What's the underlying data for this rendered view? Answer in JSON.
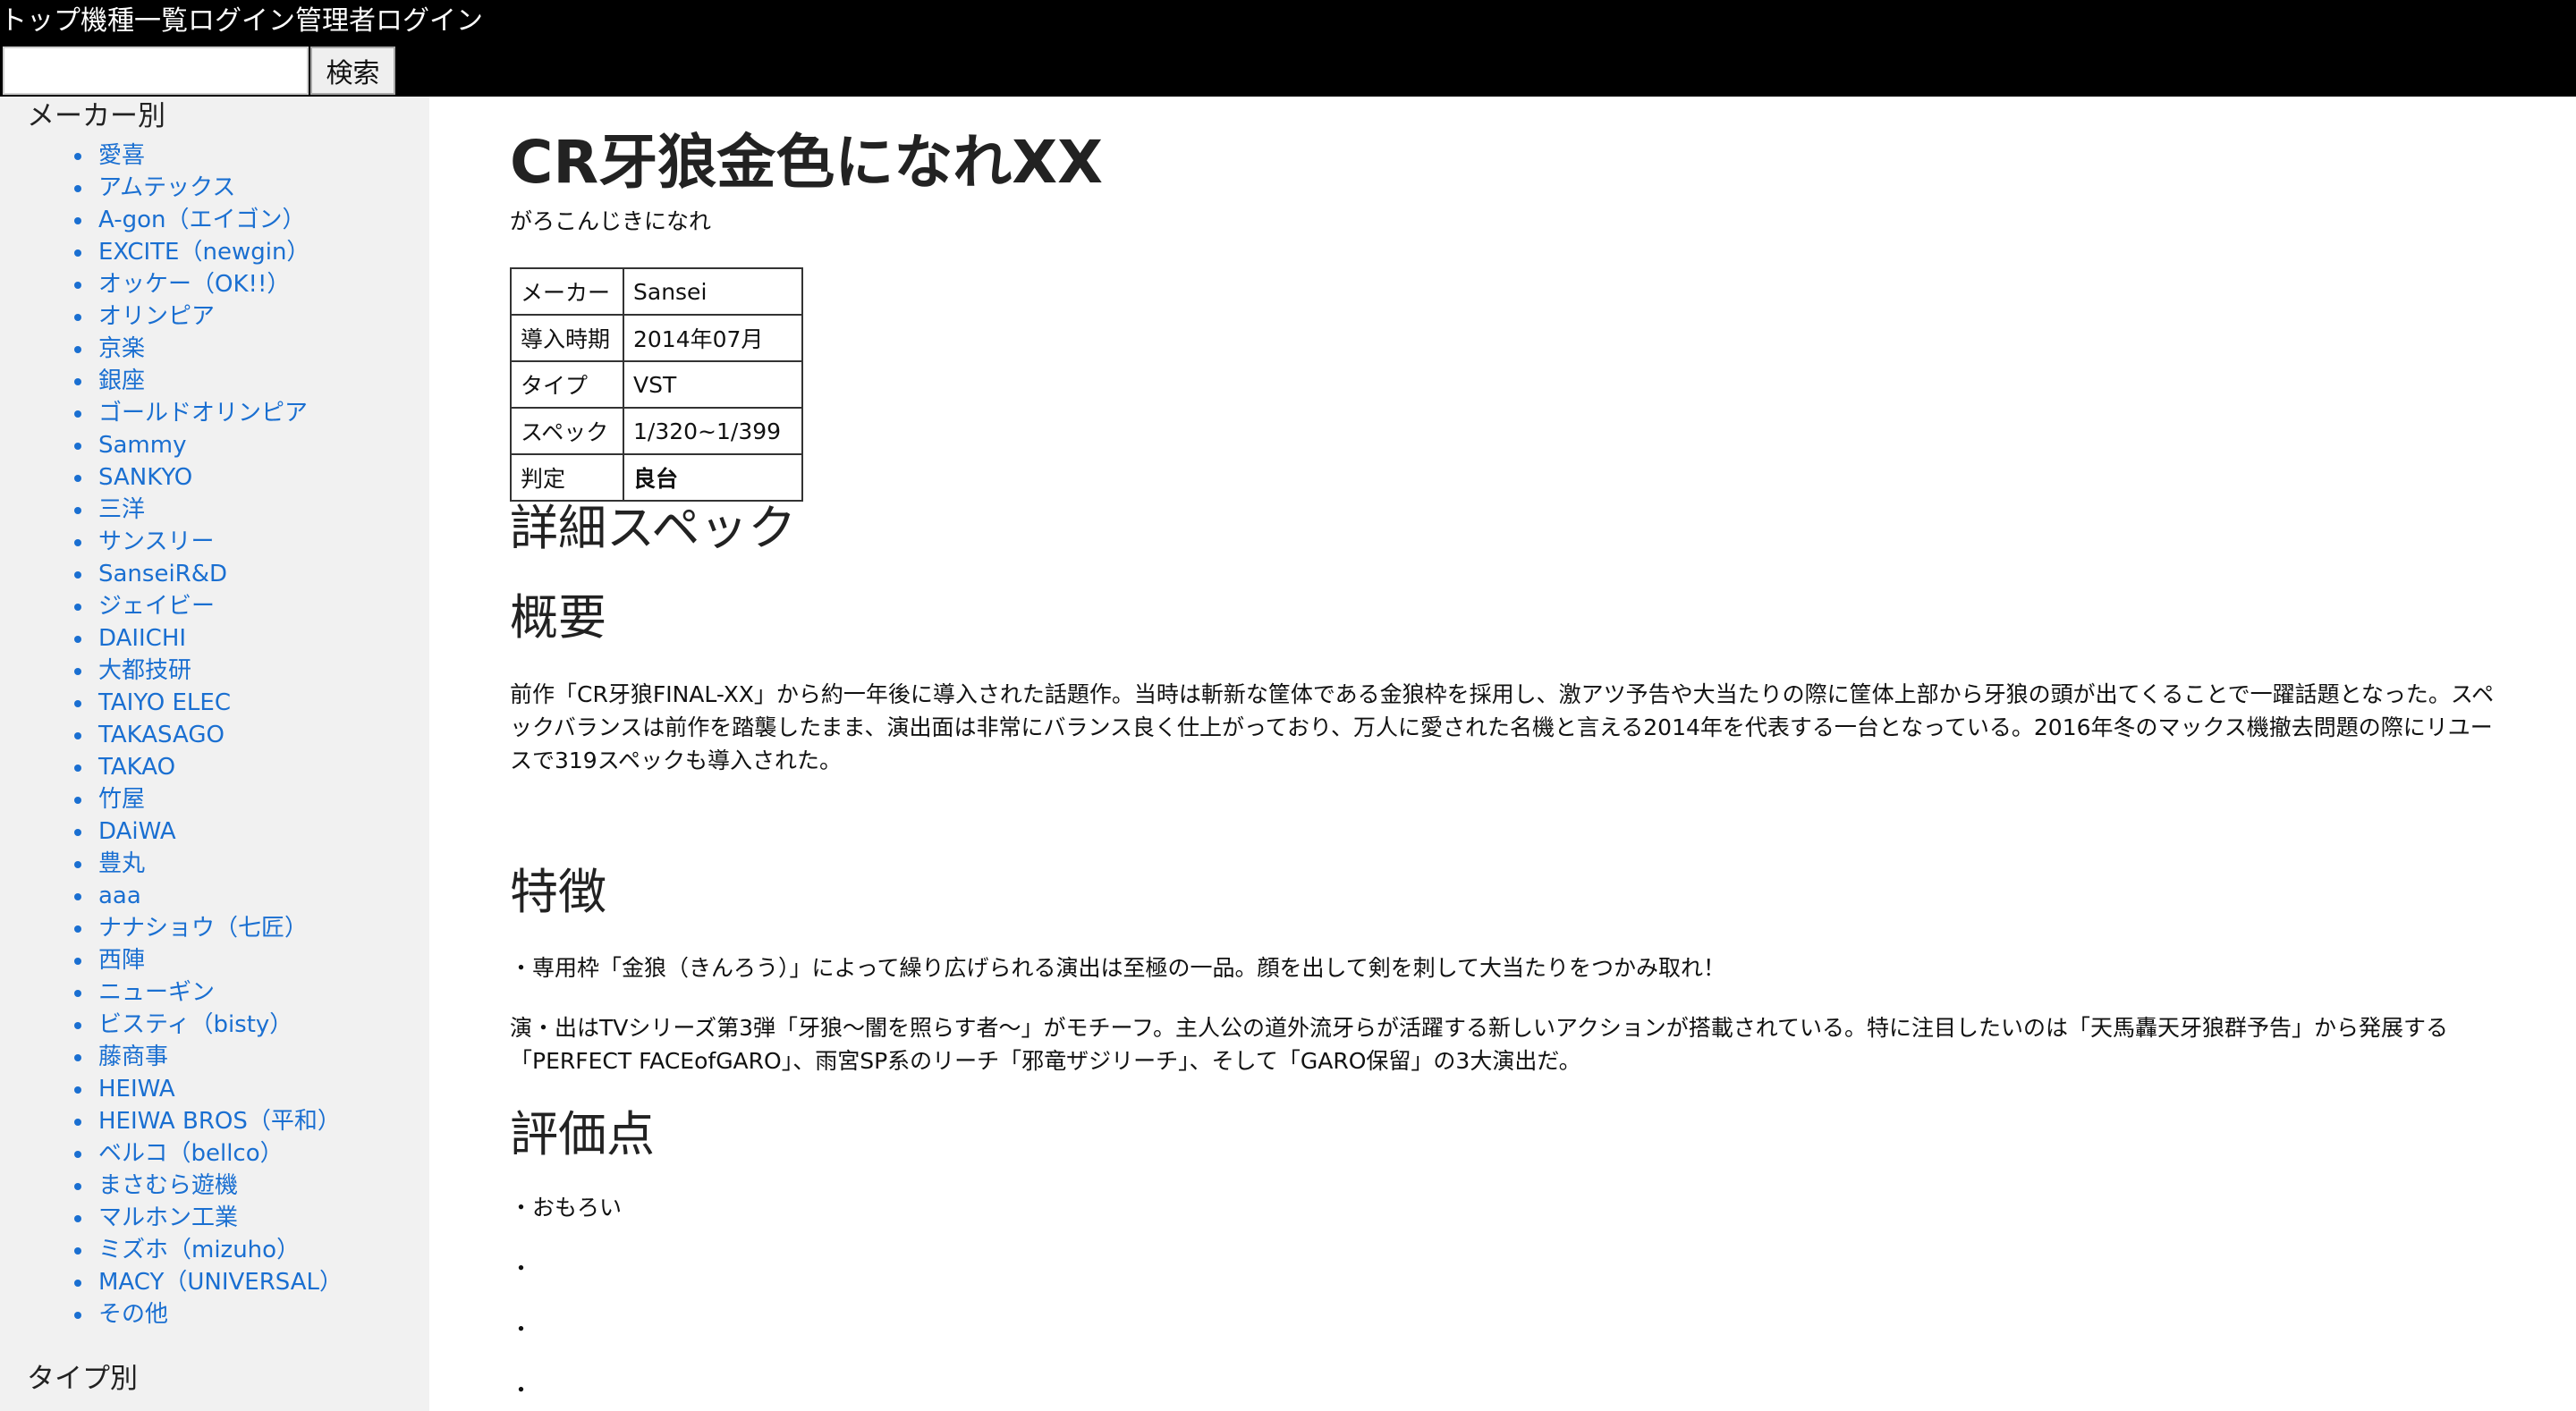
{
  "nav": {
    "top": "トップ",
    "models": "機種一覧",
    "login": "ログイン",
    "admin_login": "管理者ログイン"
  },
  "search": {
    "value": "",
    "button_label": "検索"
  },
  "sidebar": {
    "maker_heading": "メーカー別",
    "makers": [
      "愛喜",
      "アムテックス",
      "A-gon（エイゴン）",
      "EXCITE（newgin）",
      "オッケー（OK!!）",
      "オリンピア",
      "京楽",
      "銀座",
      "ゴールドオリンピア",
      "Sammy",
      "SANKYO",
      "三洋",
      "サンスリー",
      "SanseiR&D",
      "ジェイビー",
      "DAIICHI",
      "大都技研",
      "TAIYO ELEC",
      "TAKASAGO",
      "TAKAO",
      "竹屋",
      "DAiWA",
      "豊丸",
      "aaa",
      "ナナショウ（七匠）",
      "西陣",
      "ニューギン",
      "ビスティ（bisty）",
      "藤商事",
      "HEIWA",
      "HEIWA BROS（平和）",
      "ベルコ（bellco）",
      "まさむら遊機",
      "マルホン工業",
      "ミズホ（mizuho）",
      "MACY（UNIVERSAL）",
      "その他"
    ],
    "type_heading": "タイプ別"
  },
  "main": {
    "title": "CR牙狼金色になれXX",
    "subtitle": "がろこんじきになれ",
    "spec_rows": [
      {
        "label": "メーカー",
        "value": "Sansei"
      },
      {
        "label": "導入時期",
        "value": "2014年07月"
      },
      {
        "label": "タイプ",
        "value": "VST"
      },
      {
        "label": "スペック",
        "value": "1/320~1/399"
      },
      {
        "label": "判定",
        "value": "良台"
      }
    ],
    "detail_heading": "詳細スペック",
    "overview_heading": "概要",
    "overview_text": "前作「CR牙狼FINAL-XX」から約一年後に導入された話題作。当時は斬新な筐体である金狼枠を採用し、激アツ予告や大当たりの際に筐体上部から牙狼の頭が出てくることで一躍話題となった。スペックバランスは前作を踏襲したまま、演出面は非常にバランス良く仕上がっており、万人に愛された名機と言える2014年を代表する一台となっている。2016年冬のマックス機撤去問題の際にリユースで319スペックも導入された。",
    "features_heading": "特徴",
    "features_text_1": "・専用枠「金狼（きんろう）」によって繰り広げられる演出は至極の一品。顔を出して剣を刺して大当たりをつかみ取れ！",
    "features_text_2": "演・出はTVシリーズ第3弾「牙狼〜闇を照らす者〜」がモチーフ。主人公の道外流牙らが活躍する新しいアクションが搭載されている。特に注目したいのは「天馬轟天牙狼群予告」から発展する「PERFECT FACEofGARO」、雨宮SP系のリーチ「邪竜ザジリーチ」、そして「GARO保留」の3大演出だ。",
    "review_heading": "評価点",
    "review_items": [
      "・おもろい",
      "・",
      "・",
      "・"
    ]
  }
}
